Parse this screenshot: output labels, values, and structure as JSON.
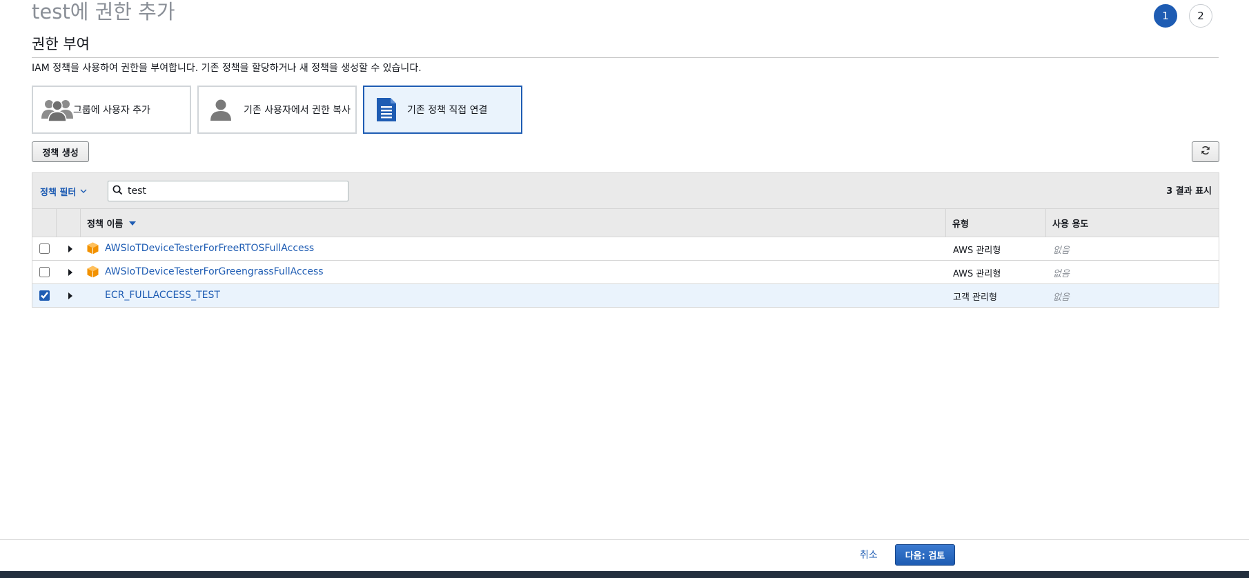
{
  "page": {
    "title": "test에 권한 추가"
  },
  "wizard": {
    "steps": [
      "1",
      "2"
    ],
    "current_step": 1
  },
  "section": {
    "title": "권한 부여",
    "description": "IAM 정책을 사용하여 권한을 부여합니다. 기존 정책을 할당하거나 새 정책을 생성할 수 있습니다."
  },
  "options": [
    {
      "label": "그룹에 사용자 추가",
      "icon": "users-group-icon",
      "selected": false
    },
    {
      "label": "기존 사용자에서 권한 복사",
      "icon": "user-icon",
      "selected": false
    },
    {
      "label": "기존 정책 직접 연결",
      "icon": "document-icon",
      "selected": true
    }
  ],
  "toolbar": {
    "create_policy_label": "정책 생성",
    "refresh_icon": "refresh-icon"
  },
  "filter": {
    "label": "정책 필터",
    "search_value": "test",
    "result_count": "3 결과 표시"
  },
  "table": {
    "columns": [
      "정책 이름",
      "유형",
      "사용 용도"
    ],
    "sorted_by": "정책 이름",
    "rows": [
      {
        "name": "AWSIoTDeviceTesterForFreeRTOSFullAccess",
        "type": "AWS 관리형",
        "usage": "없음",
        "checked": false,
        "icon": "aws-managed-cube-icon"
      },
      {
        "name": "AWSIoTDeviceTesterForGreengrassFullAccess",
        "type": "AWS 관리형",
        "usage": "없음",
        "checked": false,
        "icon": "aws-managed-cube-icon"
      },
      {
        "name": "ECR_FULLACCESS_TEST",
        "type": "고객 관리형",
        "usage": "없음",
        "checked": true,
        "icon": ""
      }
    ]
  },
  "footer": {
    "cancel_label": "취소",
    "next_label": "다음: 검토"
  },
  "colors": {
    "accent": "#1e5cb3",
    "selected_bg": "#eaf3fc",
    "aws_cube": "#f29100",
    "bottom_bar": "#232f3e"
  }
}
